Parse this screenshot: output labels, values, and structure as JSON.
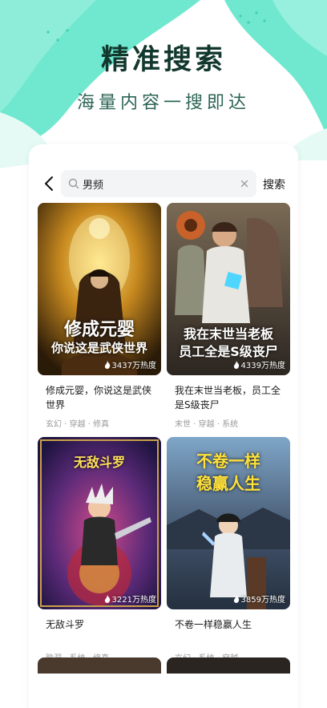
{
  "hero": {
    "title": "精准搜索",
    "subtitle": "海量内容一搜即达"
  },
  "topbar": {
    "back_icon": "chevron-left-icon",
    "search": {
      "value": "男频",
      "search_icon": "search-icon",
      "clear_icon": "close-icon"
    },
    "search_button": "搜索"
  },
  "results": [
    {
      "cover_title_line1": "修成元婴",
      "cover_title_line2": "你说这是武侠世界",
      "heat": "3437万热度",
      "name": "修成元婴，你说这是武侠世界",
      "tags": "玄幻 · 穿越 · 修真"
    },
    {
      "cover_title_line1": "我在末世当老板",
      "cover_title_line2": "员工全是S级丧尸",
      "heat": "4339万热度",
      "name": "我在末世当老板，员工全是S级丧尸",
      "tags": "末世 · 穿越 · 系统"
    },
    {
      "cover_title_line1": "无敌斗罗",
      "heat": "3221万热度",
      "name": "无敌斗罗",
      "tags": "脑洞 · 系统 · 修真"
    },
    {
      "cover_title_line1": "不卷一样",
      "cover_title_line2": "稳赢人生",
      "heat": "3859万热度",
      "name": "不卷一样稳赢人生",
      "tags": "玄幻 · 系统 · 穿越"
    }
  ],
  "colors": {
    "brand_teal": "#5fe3c7",
    "title_dark": "#12382d"
  }
}
